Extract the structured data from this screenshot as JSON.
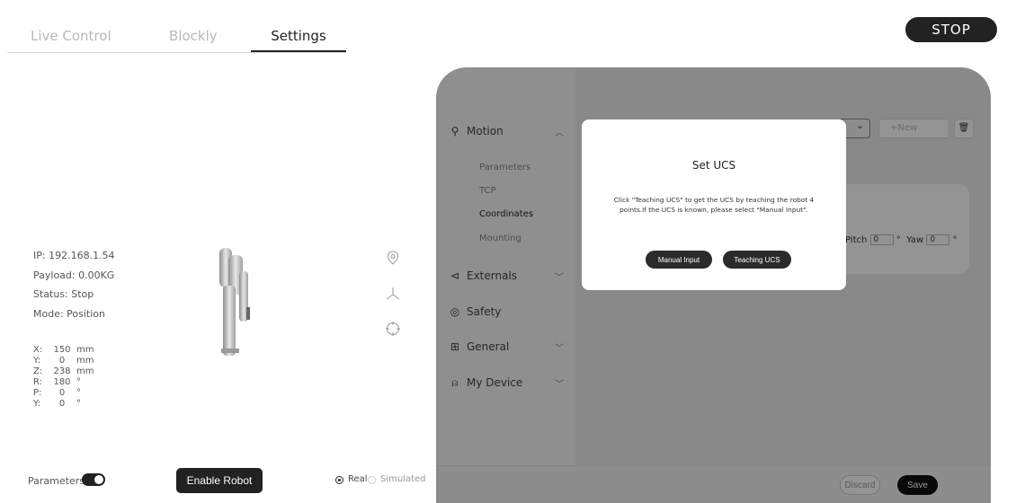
{
  "tabs": [
    {
      "label": "Live Control"
    },
    {
      "label": "Blockly"
    },
    {
      "label": "Settings"
    }
  ],
  "stop_label": "STOP",
  "status": {
    "ip": "IP: 192.168.1.54",
    "payload": "Payload: 0.00KG",
    "state": "Status: Stop",
    "mode": "Mode: Position"
  },
  "coords": [
    {
      "axis": "X:",
      "value": "150",
      "unit": "mm"
    },
    {
      "axis": "Y:",
      "value": "0",
      "unit": "mm"
    },
    {
      "axis": "Z:",
      "value": "238",
      "unit": "mm"
    },
    {
      "axis": "R:",
      "value": "180",
      "unit": "°"
    },
    {
      "axis": "P:",
      "value": "0",
      "unit": "°"
    },
    {
      "axis": "Y:",
      "value": "0",
      "unit": "°"
    }
  ],
  "bottom": {
    "parameters_label": "Parameters",
    "enable_label": "Enable Robot",
    "real_label": "Real",
    "simulated_label": "Simulated"
  },
  "settings": {
    "nav": {
      "motion": "Motion",
      "externals": "Externals",
      "safety": "Safety",
      "general": "General",
      "my_device": "My Device"
    },
    "subnav": [
      "Parameters",
      "TCP",
      "Coordinates",
      "Mounting"
    ],
    "new_label": "+New",
    "pitch_label": "Pitch",
    "pitch_value": "0",
    "yaw_label": "Yaw",
    "yaw_value": "0",
    "deg": "°",
    "discard_label": "Discard",
    "save_label": "Save"
  },
  "dialog": {
    "title": "Set UCS",
    "text": "Click \"Teaching UCS\" to get the UCS by teaching the robot 4 points.If the UCS is known, please select \"Manual Input\".",
    "manual_label": "Manual Input",
    "teaching_label": "Teaching UCS"
  }
}
